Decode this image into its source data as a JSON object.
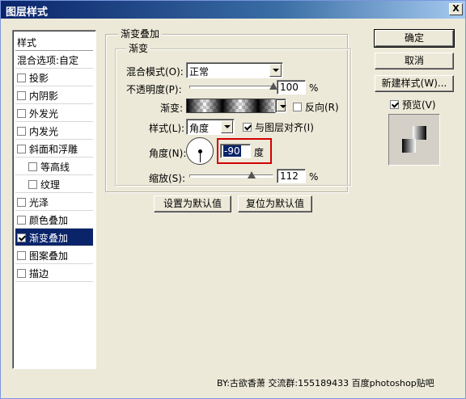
{
  "window": {
    "title": "图层样式",
    "close": "X"
  },
  "style_list": {
    "header": "样式",
    "blend_options": "混合选项:自定",
    "items": [
      {
        "label": "投影",
        "checked": false,
        "sub": false,
        "selected": false
      },
      {
        "label": "内阴影",
        "checked": false,
        "sub": false,
        "selected": false
      },
      {
        "label": "外发光",
        "checked": false,
        "sub": false,
        "selected": false
      },
      {
        "label": "内发光",
        "checked": false,
        "sub": false,
        "selected": false
      },
      {
        "label": "斜面和浮雕",
        "checked": false,
        "sub": false,
        "selected": false
      },
      {
        "label": "等高线",
        "checked": false,
        "sub": true,
        "selected": false
      },
      {
        "label": "纹理",
        "checked": false,
        "sub": true,
        "selected": false
      },
      {
        "label": "光泽",
        "checked": false,
        "sub": false,
        "selected": false
      },
      {
        "label": "颜色叠加",
        "checked": false,
        "sub": false,
        "selected": false
      },
      {
        "label": "渐变叠加",
        "checked": true,
        "sub": false,
        "selected": true
      },
      {
        "label": "图案叠加",
        "checked": false,
        "sub": false,
        "selected": false
      },
      {
        "label": "描边",
        "checked": false,
        "sub": false,
        "selected": false
      }
    ]
  },
  "gradient_overlay": {
    "group_title": "渐变叠加",
    "sub_group_title": "渐变",
    "blend_mode_label": "混合模式(O):",
    "blend_mode_value": "正常",
    "opacity_label": "不透明度(P):",
    "opacity_value": "100",
    "opacity_fraction": 1.0,
    "percent": "%",
    "gradient_label": "渐变:",
    "reverse_label": "反向(R)",
    "style_label": "样式(L):",
    "style_value": "角度",
    "align_label": "与图层对齐(I)",
    "angle_label": "角度(N):",
    "angle_value": "-90",
    "angle_unit": "度",
    "scale_label": "缩放(S):",
    "scale_value": "112",
    "scale_fraction": 0.74,
    "set_default": "设置为默认值",
    "reset_default": "复位为默认值"
  },
  "buttons": {
    "ok": "确定",
    "cancel": "取消",
    "new_style": "新建样式(W)...",
    "preview": "预览(V)"
  },
  "footer": "BY:古欲香萧  交流群:155189433  百度photoshop贴吧"
}
